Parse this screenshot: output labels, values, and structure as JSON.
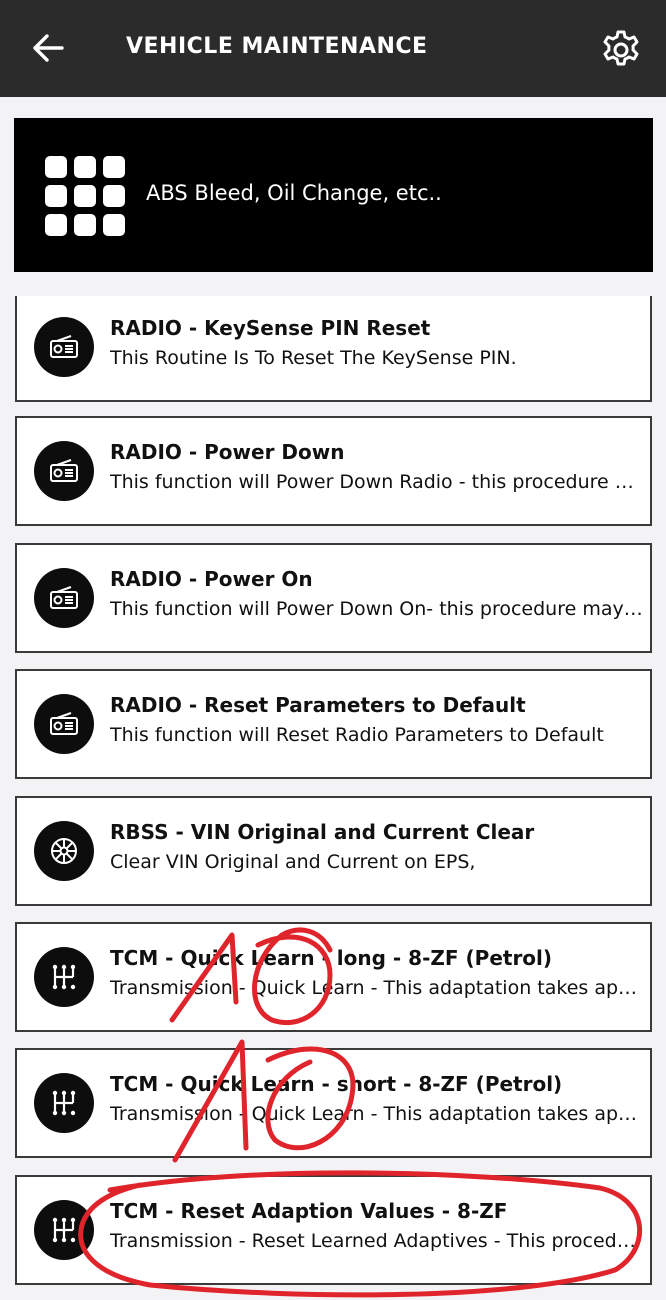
{
  "header": {
    "title": "VEHICLE MAINTENANCE",
    "back_icon": "arrow-left-icon",
    "settings_icon": "gear-icon",
    "background": "#2b2b2b"
  },
  "category": {
    "text": "ABS Bleed, Oil Change, etc..",
    "icon": "grid-icon",
    "background": "#000000"
  },
  "routines": [
    {
      "title": "RADIO - KeySense PIN Reset",
      "description": "This Routine Is To Reset The KeySense PIN.",
      "icon": "radio-icon"
    },
    {
      "title": "RADIO - Power Down",
      "description": "This function will Power Down Radio - this procedure may take a few minutes",
      "icon": "radio-icon"
    },
    {
      "title": "RADIO - Power On",
      "description": "This function will Power Down On- this procedure may take a few minutes",
      "icon": "radio-icon"
    },
    {
      "title": "RADIO - Reset Parameters to Default",
      "description": "This function will Reset Radio Parameters to Default",
      "icon": "radio-icon"
    },
    {
      "title": "RBSS - VIN Original and Current Clear",
      "description": "Clear VIN Original and Current on EPS,",
      "icon": "steering-wheel-icon"
    },
    {
      "title": "TCM - Quick Learn - long - 8-ZF (Petrol)",
      "description": "Transmission - Quick Learn - This adaptation takes approximately",
      "icon": "gear-shift-icon"
    },
    {
      "title": "TCM - Quick Learn - short - 8-ZF (Petrol)",
      "description": "Transmission - Quick Learn - This adaptation takes approximately",
      "icon": "gear-shift-icon"
    },
    {
      "title": "TCM - Reset Adaption Values - 8-ZF",
      "description": "Transmission - Reset Learned Adaptives - This procedure",
      "icon": "gear-shift-icon"
    }
  ],
  "annotation_color": "#e0242b"
}
